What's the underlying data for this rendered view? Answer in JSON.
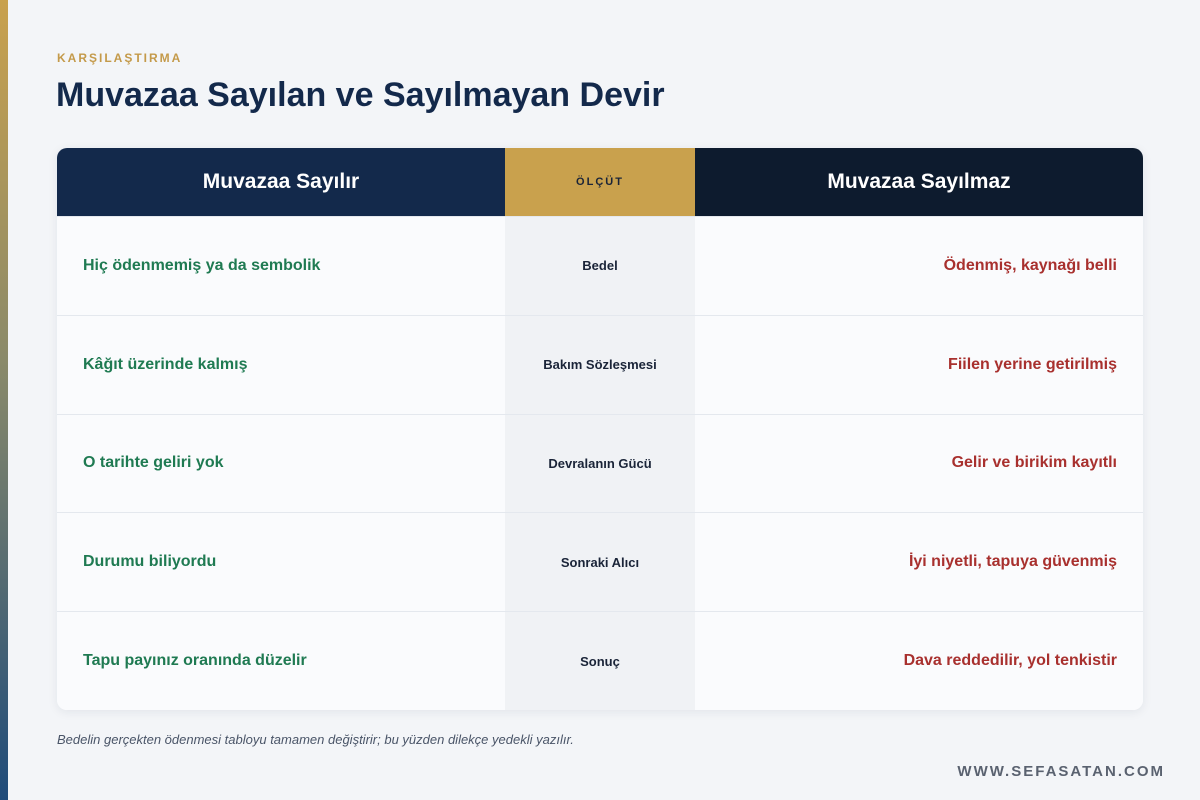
{
  "header": {
    "eyebrow": "KARŞILAŞTIRMA",
    "title": "Muvazaa Sayılan ve Sayılmayan Devir"
  },
  "table": {
    "col_left": "Muvazaa Sayılır",
    "col_mid": "ÖLÇÜT",
    "col_right": "Muvazaa Sayılmaz",
    "rows": [
      {
        "left": "Hiç ödenmemiş ya da sembolik",
        "mid": "Bedel",
        "right": "Ödenmiş, kaynağı belli"
      },
      {
        "left": "Kâğıt üzerinde kalmış",
        "mid": "Bakım Sözleşmesi",
        "right": "Fiilen yerine getirilmiş"
      },
      {
        "left": "O tarihte geliri yok",
        "mid": "Devralanın Gücü",
        "right": "Gelir ve birikim kayıtlı"
      },
      {
        "left": "Durumu biliyordu",
        "mid": "Sonraki Alıcı",
        "right": "İyi niyetli, tapuya güvenmiş"
      },
      {
        "left": "Tapu payınız oranında düzelir",
        "mid": "Sonuç",
        "right": "Dava reddedilir, yol tenkistir"
      }
    ]
  },
  "footer": {
    "note": "Bedelin gerçekten ödenmesi tabloyu tamamen değiştirir; bu yüzden dilekçe yedekli yazılır.",
    "site": "WWW.SEFASATAN.COM"
  },
  "colors": {
    "navy": "#13294b",
    "gold": "#c9a14d",
    "green": "#1f7a52",
    "red": "#a8302e"
  }
}
